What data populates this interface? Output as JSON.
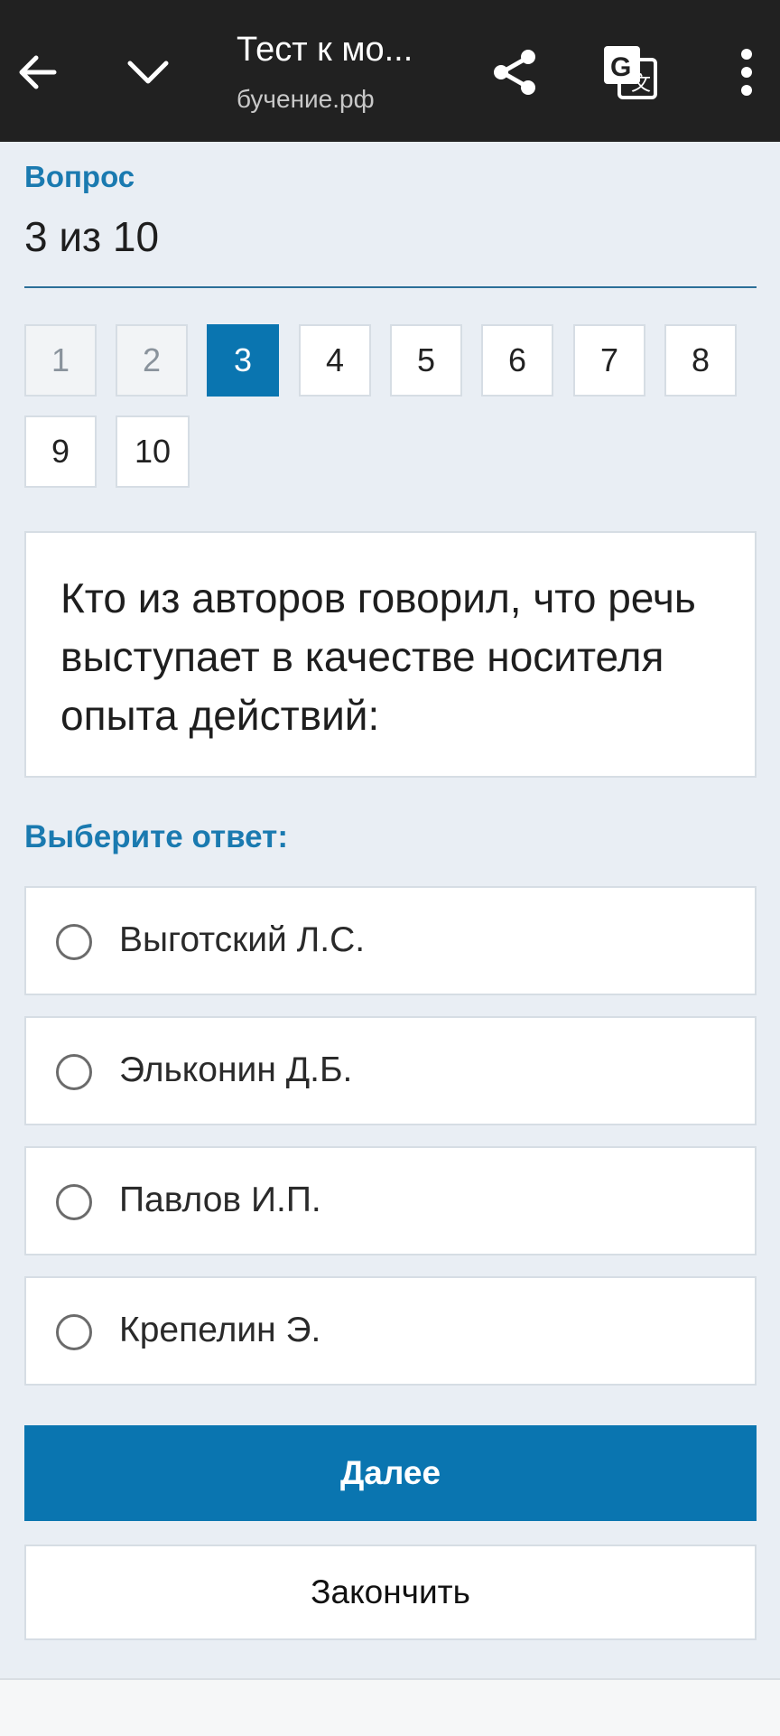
{
  "browser": {
    "title": "Тест к мо...",
    "url": "бучение.рф",
    "icons": [
      "back-arrow-icon",
      "chevron-down-icon",
      "share-icon",
      "translate-icon",
      "more-vert-icon"
    ]
  },
  "quiz": {
    "question_label": "Вопрос",
    "question_count": "3 из 10",
    "nav": [
      {
        "label": "1",
        "state": "visited"
      },
      {
        "label": "2",
        "state": "visited"
      },
      {
        "label": "3",
        "state": "current"
      },
      {
        "label": "4",
        "state": "default"
      },
      {
        "label": "5",
        "state": "default"
      },
      {
        "label": "6",
        "state": "default"
      },
      {
        "label": "7",
        "state": "default"
      },
      {
        "label": "8",
        "state": "default"
      },
      {
        "label": "9",
        "state": "default"
      },
      {
        "label": "10",
        "state": "default"
      }
    ],
    "question_text": "Кто из авторов говорил, что речь выступает в качестве носителя опыта действий:",
    "choose_label": "Выберите ответ:",
    "options": [
      {
        "label": "Выготский Л.С."
      },
      {
        "label": "Эльконин Д.Б."
      },
      {
        "label": "Павлов И.П."
      },
      {
        "label": "Крепелин Э."
      }
    ],
    "next_label": "Далее",
    "finish_label": "Закончить"
  },
  "colors": {
    "accent": "#0a75b0",
    "label_blue": "#1a7ab0",
    "page_bg": "#e9eef4",
    "topbar_bg": "#212121"
  }
}
